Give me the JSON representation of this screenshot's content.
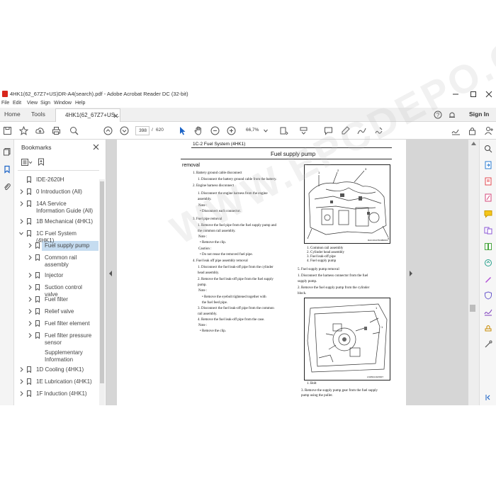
{
  "window": {
    "title": "4HK1(62_67Z7+US)DR-A4(search).pdf - Adobe Acrobat Reader DC (32-bit)"
  },
  "menu": [
    "File",
    "Edit",
    "View",
    "Sign",
    "Window",
    "Help"
  ],
  "tabs": {
    "home": "Home",
    "tools": "Tools",
    "document": "4HK1(62_67Z7+US...",
    "sign_in": "Sign In"
  },
  "toolbar": {
    "page_current": "398",
    "page_separator": "/",
    "page_total": "620",
    "zoom": "66,7%"
  },
  "bookmarks": {
    "header": "Bookmarks",
    "items": [
      {
        "label": "IDE-2620H"
      },
      {
        "label": "0 Introduction (All)"
      },
      {
        "label": "14A Service Information Guide (All)"
      },
      {
        "label": "1B Mechanical (4HK1)"
      },
      {
        "label": "1C Fuel System (4HK1)"
      },
      {
        "label": "Fuel supply pump"
      },
      {
        "label": "Common rail assembly"
      },
      {
        "label": "Injector"
      },
      {
        "label": "Suction control valve"
      },
      {
        "label": "Fuel filter"
      },
      {
        "label": "Relief valve"
      },
      {
        "label": "Fuel filter element"
      },
      {
        "label": "Fuel filter pressure sensor"
      },
      {
        "label": "Supplementary Information"
      },
      {
        "label": "1D Cooling (4HK1)"
      },
      {
        "label": "1E Lubrication (4HK1)"
      },
      {
        "label": "1F Induction (4HK1)"
      }
    ]
  },
  "manual_page": {
    "header": "1C-2   Fuel System (4HK1)",
    "title": "Fuel supply pump",
    "section": "removal",
    "left_col": [
      "1.   Battery ground cable  disconnect",
      "1.   Disconnect the battery ground cable from the battery.",
      "2.   Engine harness  disconnect",
      "1.   Disconnect the engine harness from the engine",
      "      assembly.",
      "Note :",
      "•    Disconnect each connector.",
      "3.   Fuel pipe  removal",
      "1.   Remove the fuel pipe from the fuel supply pump and",
      "      the common rail assembly.",
      "Note :",
      "•    Remove the clip.",
      "Caution :",
      "•    Do not reuse the removed fuel pipe.",
      "4.   Fuel leak off pipe assembly  removal",
      "1.   Disconnect the fuel leak-off pipe from the cylinder",
      "      head assembly.",
      "2.   Remove the fuel leak-off pipe from the fuel supply",
      "      pump.",
      "Note :",
      "•    Remove the eyebolt tightened together with",
      "      the fuel feed pipe.",
      "3.   Disconnect the fuel leak-off pipe from the common",
      "      rail assembly.",
      "4.   Remove the fuel leak-off pipe from the case.",
      "Note :",
      "•    Remove the clip."
    ],
    "fig1_legend": [
      "1.   Common rail assembly",
      "2.   Cylinder head assembly",
      "3.   Fuel leak-off pipe",
      "4.   Fuel supply pump"
    ],
    "fig1_code": "RAC43147604B0001",
    "right_col": [
      "5.   Fuel supply pump  removal",
      "1.   Disconnect the harness connector from the fuel",
      "      supply pump.",
      "2.   Remove the fuel supply pump from the cylinder",
      "      block."
    ],
    "fig2_code": "LNW6AC2H5007",
    "fig2_legend": [
      "1.   Bolt"
    ],
    "bottom_col": [
      "3.   Remove the supply pump gear from the fuel supply",
      "      pump using the puller."
    ]
  },
  "watermark": "WWW.EPCDEPO.COM"
}
